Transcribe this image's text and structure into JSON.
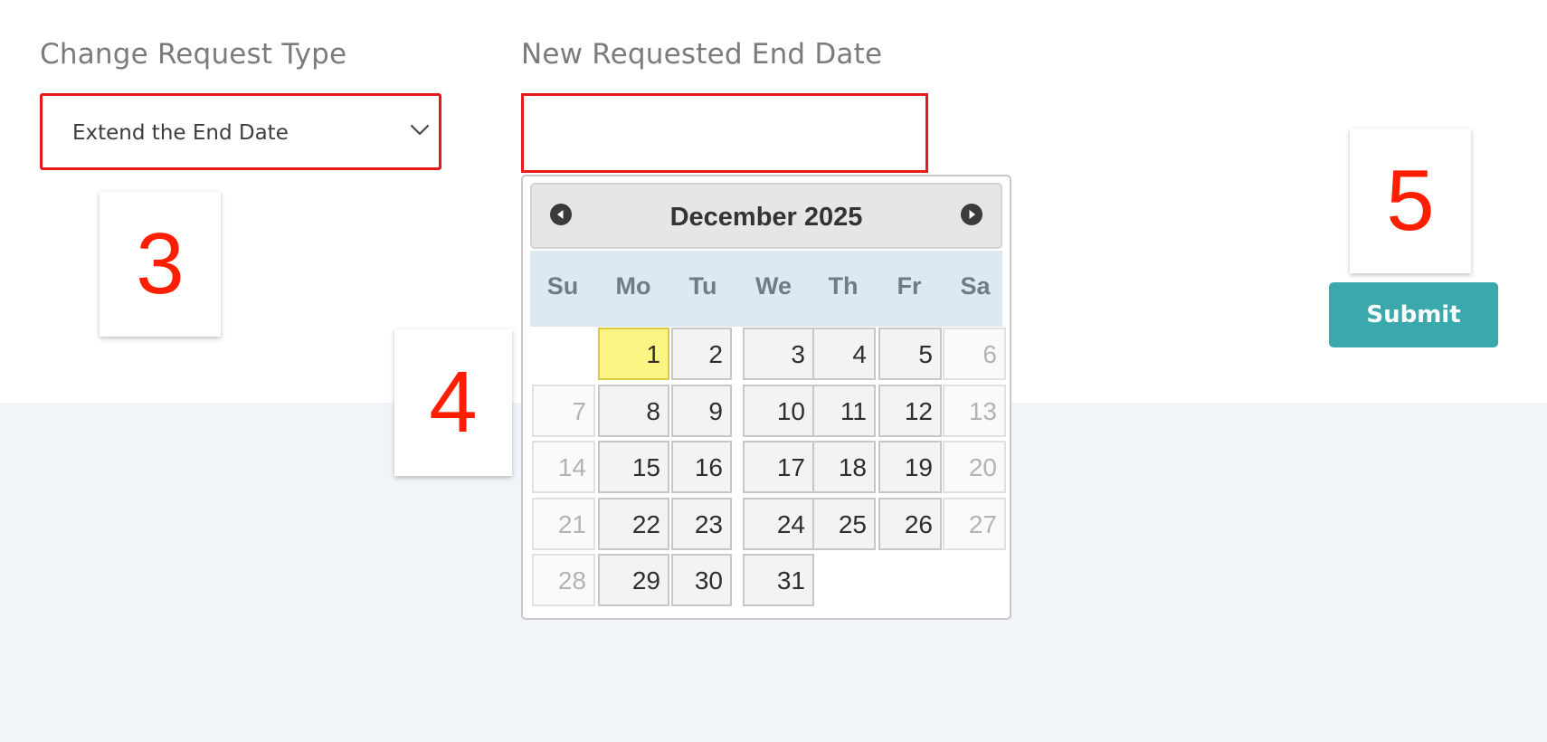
{
  "form": {
    "change_type_label": "Change Request Type",
    "change_type_value": "Extend the End Date",
    "end_date_label": "New Requested End Date",
    "end_date_value": "",
    "submit_label": "Submit"
  },
  "callouts": [
    "3",
    "4",
    "5"
  ],
  "calendar": {
    "month_title": "December 2025",
    "prev_icon": "circle-arrow-left-icon",
    "next_icon": "circle-arrow-right-icon",
    "weekdays": [
      "Su",
      "Mo",
      "Tu",
      "We",
      "Th",
      "Fr",
      "Sa"
    ],
    "highlighted_day": "1",
    "days": [
      "1",
      "2",
      "3",
      "4",
      "5",
      "6",
      "7",
      "8",
      "9",
      "10",
      "11",
      "12",
      "13",
      "14",
      "15",
      "16",
      "17",
      "18",
      "19",
      "20",
      "21",
      "22",
      "23",
      "24",
      "25",
      "26",
      "27",
      "28",
      "29",
      "30",
      "31"
    ]
  },
  "colors": {
    "highlight_border": "#e8191b",
    "callout_number": "#ff1f00",
    "submit_button": "#3aa8ac",
    "today_cell": "#fbf583",
    "weekday_header": "#dde9f1",
    "page_lower_band": "#f1f5f9"
  }
}
